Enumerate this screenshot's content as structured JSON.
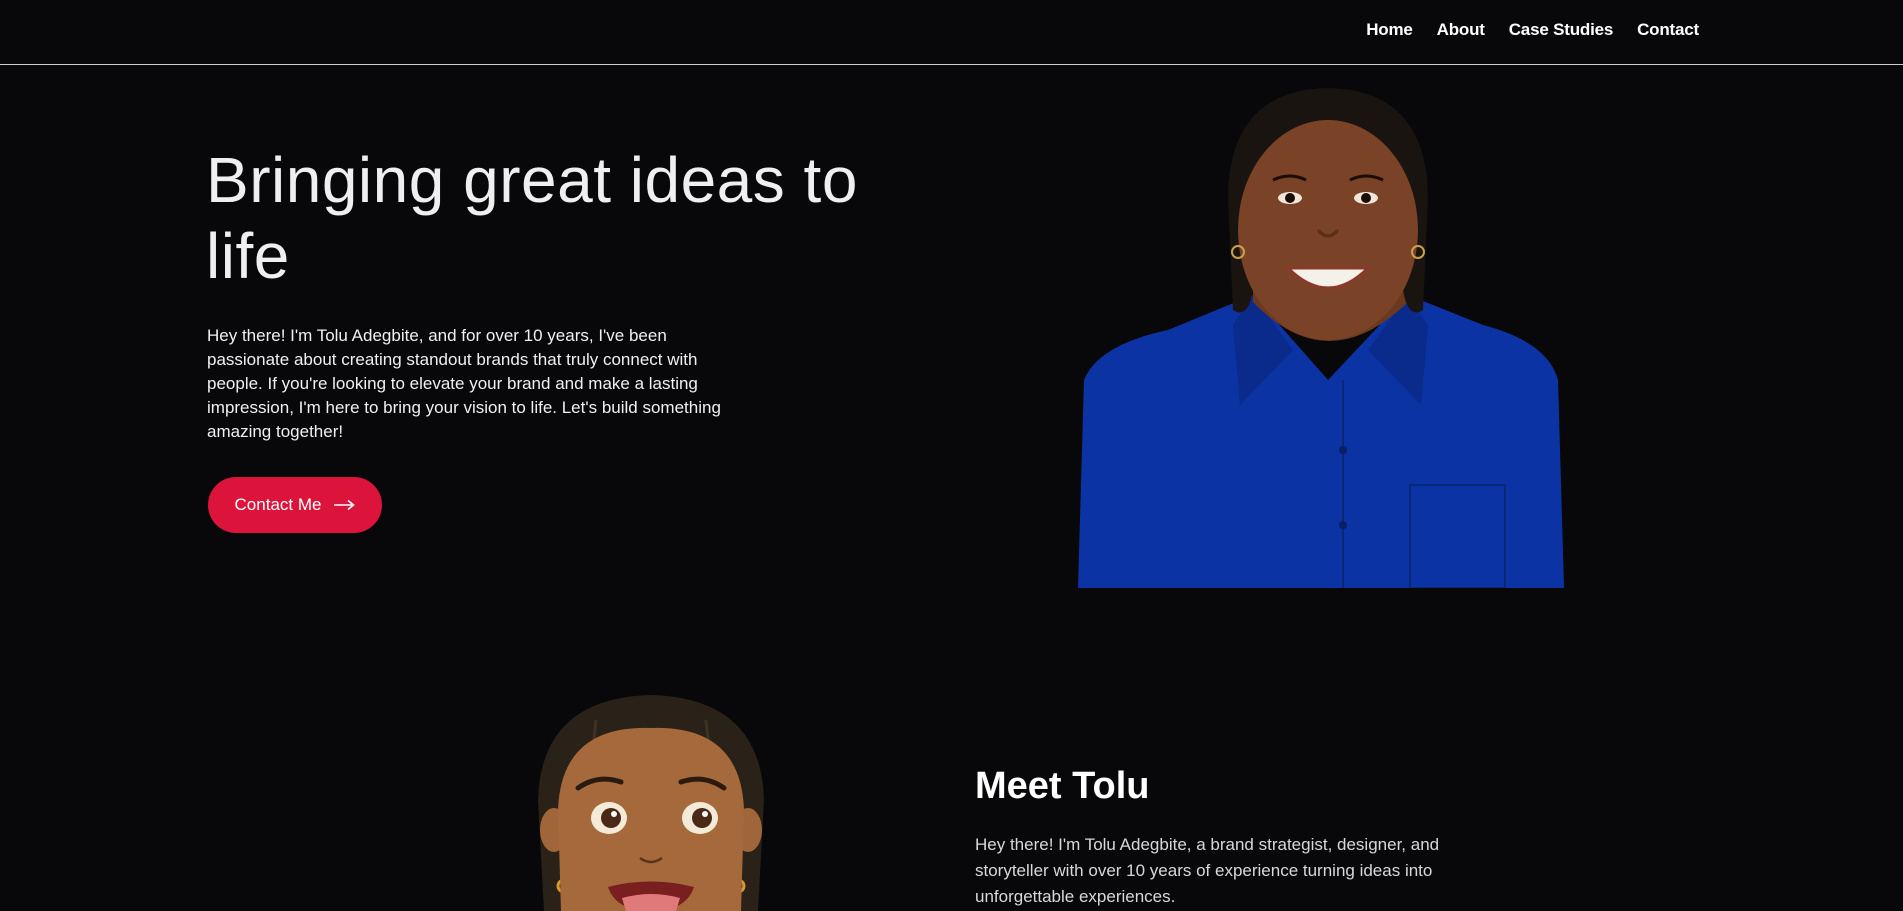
{
  "nav": {
    "items": [
      {
        "label": "Home"
      },
      {
        "label": "About"
      },
      {
        "label": "Case Studies"
      },
      {
        "label": "Contact"
      }
    ]
  },
  "hero": {
    "title": "Bringing great ideas to life",
    "intro": "Hey there! I'm Tolu Adegbite, and for over 10 years, I've been passionate about creating standout brands that truly connect with people. If you're looking to elevate your brand and make a lasting impression, I'm here to bring your vision to life. Let's build something amazing together!",
    "cta_label": "Contact Me",
    "cta_icon": "arrow-right-icon",
    "cta_color": "#dc143c"
  },
  "about": {
    "title": "Meet Tolu",
    "text": "Hey there! I'm Tolu Adegbite, a brand strategist, designer, and storyteller with over 10 years of experience turning ideas into unforgettable experiences."
  },
  "colors": {
    "background": "#08080a",
    "nav_border": "#cfcfcf",
    "shirt": "#0c33a3",
    "skin": "#7a4226"
  }
}
